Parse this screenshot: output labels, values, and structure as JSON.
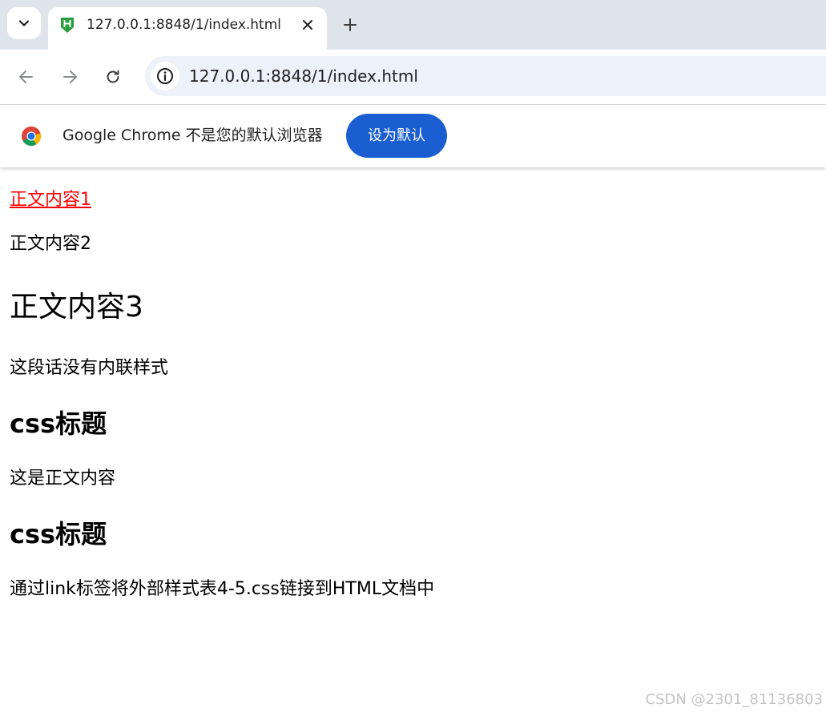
{
  "browser": {
    "tab": {
      "title": "127.0.0.1:8848/1/index.html",
      "favicon": "hbuilder-h-icon",
      "favicon_color": "#2a9d3f"
    },
    "url": "127.0.0.1:8848/1/index.html",
    "icons": {
      "tab_search": "chevron-down-icon",
      "close": "close-icon",
      "new_tab": "plus-icon",
      "back": "back-arrow-icon",
      "forward": "forward-arrow-icon",
      "reload": "reload-icon",
      "site_info": "info-icon"
    }
  },
  "infobar": {
    "message": "Google Chrome 不是您的默认浏览器",
    "button_label": "设为默认",
    "button_color": "#1a5ed1"
  },
  "page": {
    "line1": "正文内容1",
    "line1_color": "#ff0000",
    "line2": "正文内容2",
    "line3": "正文内容3",
    "line4": "这段话没有内联样式",
    "heading1": "css标题",
    "line5": "这是正文内容",
    "heading2": "css标题",
    "line6": "通过link标签将外部样式表4-5.css链接到HTML文档中"
  },
  "watermark": "CSDN @2301_81136803"
}
